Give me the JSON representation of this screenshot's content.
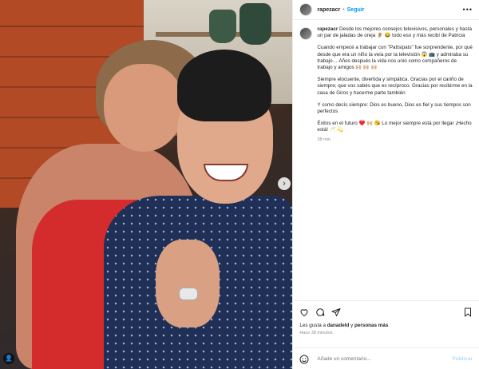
{
  "post": {
    "username": "rapezacr",
    "follow_label": "Seguir",
    "more_label": "•••",
    "caption": [
      "Desde los mejores consejos televisivos, personales y hasta un par de jaladas de oreja 👂🏼 😂 todo eso y más recibí de Patricia",
      "Cuando empecé a trabajar con \"Pattsipats\" fue sorprendente, por qué desde que era un niño la veía por la televisión 😱 📺 y admiraba su trabajo… Años después la vida nos unió como compañeros de trabajo y amigos 🙌🏼 🙌🏼 🙌🏼",
      "Siempre elocuente, divertida y simpática. Gracias por el cariño de siempre; que vos sabés que es recíproco. Gracias por recibirme en la casa de Giros y hacerme parte también",
      "Y como decís siempre: Dios es bueno, Dios es fiel y sus tiempos son perfectos",
      "Éxitos en el futuro ♥️ 🙌🏼 😘 Lo mejor siempre está por llegar ¡Hecho está! 🥂 💫"
    ],
    "caption_time": "38 min",
    "likes_prefix": "Les gusta a ",
    "likes_user": "danadeld",
    "likes_join": " y ",
    "likes_others": "personas más",
    "posted_ago": "Hace 38 minutos",
    "comment_placeholder": "Añade un comentario...",
    "publish_label": "Publicar",
    "next_glyph": "›",
    "tag_glyph": "👤"
  },
  "icons": [
    "like-heart-icon",
    "comment-bubble-icon",
    "share-send-icon",
    "bookmark-save-icon",
    "emoji-icon"
  ],
  "colors": {
    "link": "#0095f6",
    "muted": "#8e8e8e",
    "publish_disabled": "#b3dbff"
  }
}
